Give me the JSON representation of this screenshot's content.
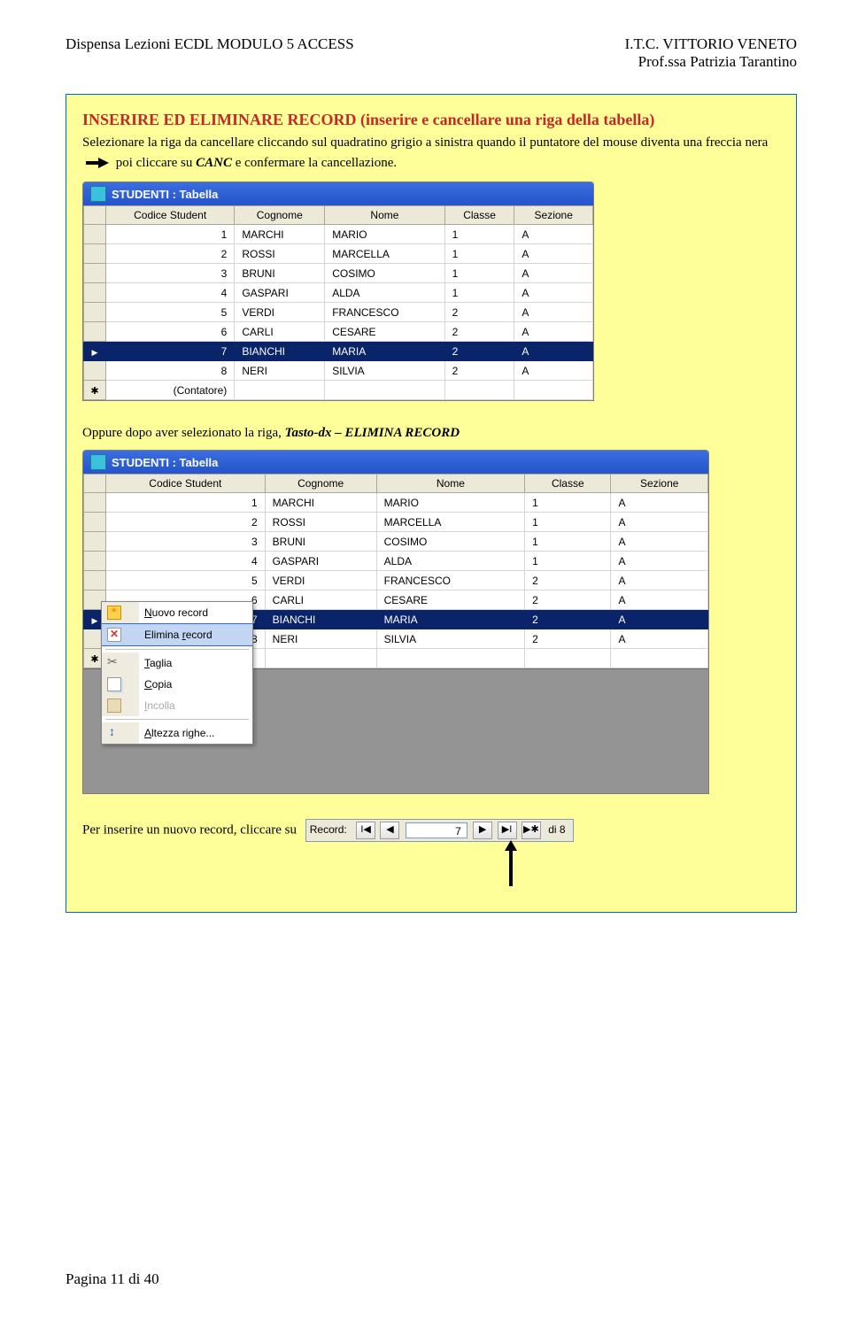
{
  "header": {
    "left": "Dispensa Lezioni ECDL  MODULO 5 ACCESS",
    "right1": "I.T.C. VITTORIO VENETO",
    "right2": "Prof.ssa Patrizia Tarantino"
  },
  "title": "INSERIRE ED ELIMINARE RECORD (inserire e cancellare una riga della tabella)",
  "para1": "Selezionare la riga da cancellare cliccando sul quadratino grigio a sinistra quando il puntatore del mouse diventa una freccia nera",
  "para2a": "poi cliccare su ",
  "para2b": "CANC",
  "para2c": " e confermare la cancellazione.",
  "tableTitle": "STUDENTI : Tabella",
  "cols": [
    "Codice Student",
    "Cognome",
    "Nome",
    "Classe",
    "Sezione"
  ],
  "rows": [
    {
      "id": "1",
      "c": "MARCHI",
      "n": "MARIO",
      "cl": "1",
      "s": "A"
    },
    {
      "id": "2",
      "c": "ROSSI",
      "n": "MARCELLA",
      "cl": "1",
      "s": "A"
    },
    {
      "id": "3",
      "c": "BRUNI",
      "n": "COSIMO",
      "cl": "1",
      "s": "A"
    },
    {
      "id": "4",
      "c": "GASPARI",
      "n": "ALDA",
      "cl": "1",
      "s": "A"
    },
    {
      "id": "5",
      "c": "VERDI",
      "n": "FRANCESCO",
      "cl": "2",
      "s": "A"
    },
    {
      "id": "6",
      "c": "CARLI",
      "n": "CESARE",
      "cl": "2",
      "s": "A"
    },
    {
      "id": "7",
      "c": "BIANCHI",
      "n": "MARIA",
      "cl": "2",
      "s": "A"
    },
    {
      "id": "8",
      "c": "NERI",
      "n": "SILVIA",
      "cl": "2",
      "s": "A"
    }
  ],
  "contatore": "(Contatore)",
  "mid1": "Oppure dopo aver selezionato la riga, ",
  "mid2": "Tasto-dx – ELIMINA RECORD",
  "menu": {
    "new": "Nuovo record",
    "del": "Elimina record",
    "cut": "Taglia",
    "copy": "Copia",
    "paste": "Incolla",
    "rowh": "Altezza righe..."
  },
  "bottom": "Per inserire un nuovo record, cliccare su",
  "nav": {
    "label": "Record:",
    "val": "7",
    "of": "di 8"
  },
  "footer": "Pagina 11 di 40"
}
